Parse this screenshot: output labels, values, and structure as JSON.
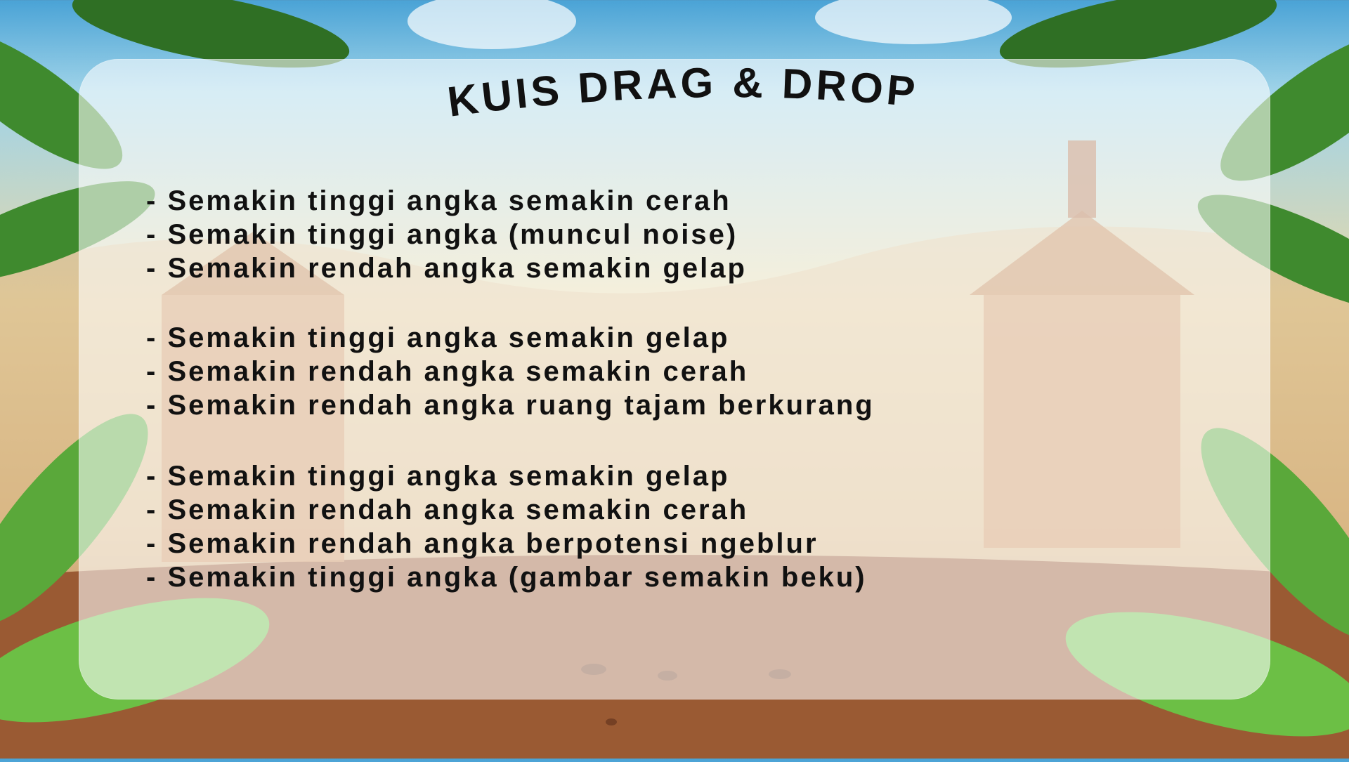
{
  "title": "KUIS DRAG & DROP",
  "groups": [
    {
      "items": [
        "Semakin tinggi angka semakin cerah",
        "Semakin tinggi angka (muncul noise)",
        "Semakin rendah angka semakin gelap"
      ]
    },
    {
      "items": [
        "Semakin tinggi angka semakin gelap",
        "Semakin rendah angka semakin cerah",
        "Semakin rendah angka ruang tajam berkurang"
      ]
    },
    {
      "items": [
        "Semakin tinggi angka semakin gelap",
        "Semakin rendah angka semakin cerah",
        "Semakin rendah angka berpotensi ngeblur",
        "Semakin tinggi angka (gambar semakin beku)"
      ]
    }
  ],
  "colors": {
    "panel": "#ffffff",
    "text": "#111111",
    "sky": "#4aa3d6",
    "sand": "#e9d9a8",
    "soil": "#8a4a2a",
    "leaf": "#3f8a2e"
  }
}
